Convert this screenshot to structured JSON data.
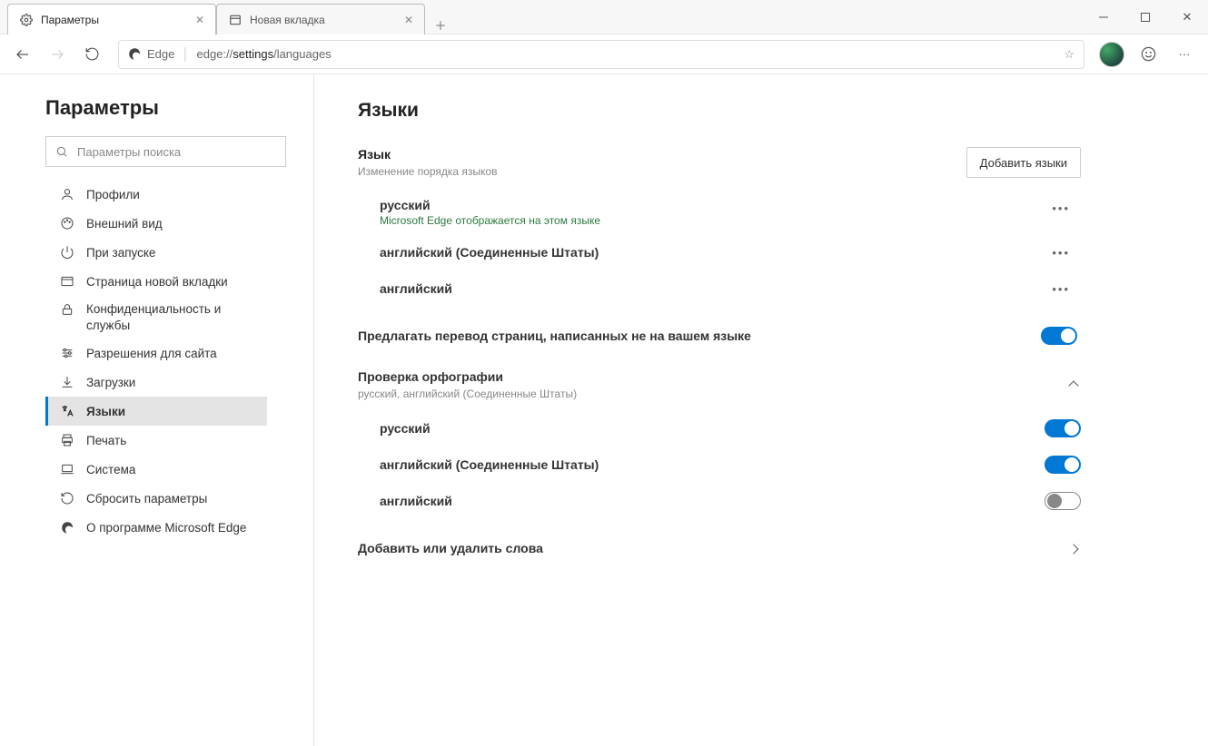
{
  "tabs": [
    {
      "title": "Параметры",
      "active": true
    },
    {
      "title": "Новая вкладка",
      "active": false
    }
  ],
  "address": {
    "app": "Edge",
    "url_prefix": "edge://",
    "url_bold": "settings",
    "url_suffix": "/languages"
  },
  "sidebar": {
    "title": "Параметры",
    "search_placeholder": "Параметры поиска",
    "items": [
      {
        "label": "Профили"
      },
      {
        "label": "Внешний вид"
      },
      {
        "label": "При запуске"
      },
      {
        "label": "Страница новой вкладки"
      },
      {
        "label": "Конфиденциальность и службы"
      },
      {
        "label": "Разрешения для сайта"
      },
      {
        "label": "Загрузки"
      },
      {
        "label": "Языки",
        "active": true
      },
      {
        "label": "Печать"
      },
      {
        "label": "Система"
      },
      {
        "label": "Сбросить параметры"
      },
      {
        "label": "О программе Microsoft Edge"
      }
    ]
  },
  "main": {
    "heading": "Языки",
    "language_section": {
      "title": "Язык",
      "subtitle": "Изменение порядка языков",
      "add_button": "Добавить языки",
      "items": [
        {
          "name": "русский",
          "note": "Microsoft Edge отображается на этом языке"
        },
        {
          "name": "английский (Соединенные Штаты)"
        },
        {
          "name": "английский"
        }
      ]
    },
    "translate_option": {
      "label": "Предлагать перевод страниц, написанных не на вашем языке",
      "on": true
    },
    "spellcheck": {
      "title": "Проверка орфографии",
      "subtitle": "русский, английский (Соединенные Штаты)",
      "items": [
        {
          "name": "русский",
          "on": true
        },
        {
          "name": "английский (Соединенные Штаты)",
          "on": true
        },
        {
          "name": "английский",
          "on": false
        }
      ],
      "add_remove": "Добавить или удалить слова"
    }
  }
}
